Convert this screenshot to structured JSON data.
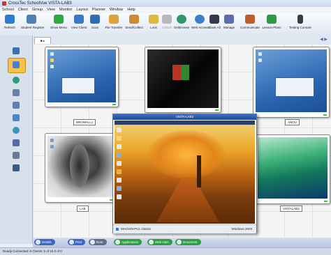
{
  "app": {
    "title": "CrossTec SchoolVue  VISTA-LAB3",
    "menu": [
      "School",
      "Client",
      "Group",
      "View",
      "Monitor",
      "Layout",
      "Planner",
      "Window",
      "Help"
    ]
  },
  "toolbar": {
    "items": [
      {
        "label": "Refresh",
        "icon": "refresh-icon",
        "color": "#2b7bd6"
      },
      {
        "label": "Student Register",
        "icon": "register-icon",
        "color": "#4e7db8"
      },
      {
        "label": "Show Menu",
        "icon": "play-icon",
        "color": "#2eaa3d"
      },
      {
        "label": "View Client",
        "icon": "view-client-icon",
        "color": "#3a79c9"
      },
      {
        "label": "Scan",
        "icon": "scan-icon",
        "color": "#2e6bb5"
      },
      {
        "label": "File Transfer",
        "icon": "file-transfer-icon",
        "color": "#e0a23a"
      },
      {
        "label": "Send/Collect",
        "icon": "send-collect-icon",
        "color": "#d08a2e"
      },
      {
        "label": "Lock",
        "icon": "lock-icon",
        "color": "#e5b63c"
      },
      {
        "label": "Unlock",
        "icon": "unlock-icon",
        "color": "#b9b9b9"
      },
      {
        "label": "On/Browse",
        "icon": "globe-icon",
        "color": "#2f9a6e"
      },
      {
        "label": "Web Access",
        "icon": "web-icon",
        "color": "#3d7fcc"
      },
      {
        "label": "Blank All",
        "icon": "monitor-icon",
        "color": "#333b4a"
      },
      {
        "label": "Manage",
        "icon": "manage-icon",
        "color": "#5b6fb0"
      },
      {
        "label": "Communicate",
        "icon": "communicate-icon",
        "color": "#c15d2a"
      },
      {
        "label": "Lesson Plans",
        "icon": "lesson-plans-icon",
        "color": "#2c9b46"
      },
      {
        "label": "Testing Console",
        "icon": "testing-icon",
        "color": "#3b3b3b"
      }
    ]
  },
  "sidebar": {
    "items": [
      {
        "icon": "group-icon",
        "color": "#3b6fb0",
        "selected": false
      },
      {
        "icon": "monitor-icon",
        "color": "#4b7fd0",
        "selected": true
      },
      {
        "icon": "globe-icon",
        "color": "#2d9a7b",
        "selected": false
      },
      {
        "icon": "document-icon",
        "color": "#6a7fa6",
        "selected": false
      },
      {
        "icon": "clipboard-icon",
        "color": "#5e7fb6",
        "selected": false
      },
      {
        "icon": "chat-icon",
        "color": "#4b87c8",
        "selected": false
      },
      {
        "icon": "audio-icon",
        "color": "#3e95b8",
        "selected": false
      },
      {
        "icon": "users-icon",
        "color": "#566aa8",
        "selected": false
      },
      {
        "icon": "printer-icon",
        "color": "#6b7a90",
        "selected": false
      },
      {
        "icon": "book-icon",
        "color": "#3d5a80",
        "selected": false
      }
    ]
  },
  "tabs": [
    {
      "label": "■ ▸"
    }
  ],
  "clients": [
    {
      "label": "BROWALL1",
      "desktop": "blue"
    },
    {
      "label": "",
      "desktop": "black"
    },
    {
      "label": "ANOU",
      "desktop": "blue"
    },
    {
      "label": "LAB",
      "desktop": "sketch"
    },
    {
      "label": "VISTALAB3",
      "desktop": "vista"
    }
  ],
  "view_window": {
    "title": "VISTA-LAB3",
    "status_left": "MACHIN-PC1   classlo",
    "status_right": "Windows 2003"
  },
  "bottom_buttons": [
    {
      "label": "Details",
      "color": "#3b68c8"
    },
    {
      "label": "Print",
      "color": "#3b68c8"
    },
    {
      "label": "Note",
      "color": "#5f6e8a"
    },
    {
      "label": "Applications",
      "color": "#2c9e43"
    },
    {
      "label": "Web sites",
      "color": "#2c9e43"
    },
    {
      "label": "Document",
      "color": "#2c9e43"
    }
  ],
  "statusbar": {
    "text": "Ready     Connected: 6     Clients: 5 of 10     0 of 0"
  }
}
